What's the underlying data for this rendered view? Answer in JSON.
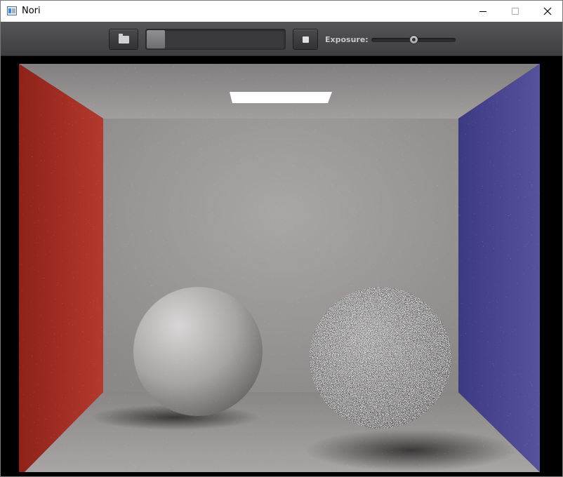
{
  "window": {
    "title": "Nori"
  },
  "titlebar_buttons": {
    "minimize": "minimize",
    "maximize": "maximize",
    "close": "close"
  },
  "toolbar": {
    "open_icon": "folder-icon",
    "stop_icon": "stop-icon",
    "progress_fraction": 0.1,
    "exposure_label": "Exposure:",
    "exposure_slider_fraction": 0.5
  },
  "render": {
    "scene": "cornell-box",
    "colors": {
      "left_wall": "#a52a20",
      "right_wall": "#4a4a96",
      "back_wall": "#9a9696",
      "light": "#ffffff"
    }
  }
}
